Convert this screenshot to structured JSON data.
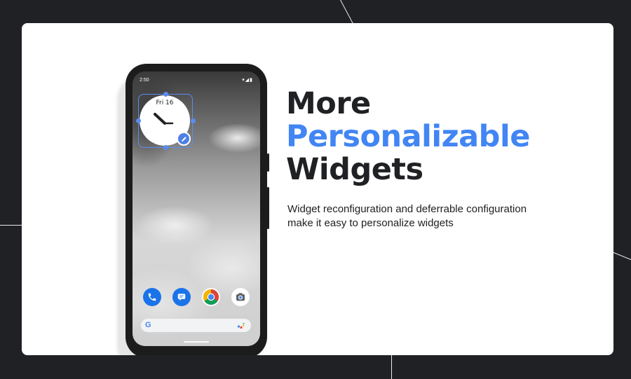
{
  "phone": {
    "status_time": "2:50",
    "status_icons": "▾◢▮",
    "clock_widget": {
      "date": "Fri 16"
    },
    "dock_icons": [
      "phone-icon",
      "messages-icon",
      "chrome-icon",
      "camera-icon"
    ],
    "search_bar": {
      "logo": "G",
      "assistant_icon": "assistant-icon"
    }
  },
  "headline": {
    "line1": "More",
    "line2": "Personalizable",
    "line3": "Widgets"
  },
  "subtitle": {
    "line1": "Widget reconfiguration and deferrable configuration",
    "line2": "make it easy to personalize widgets"
  },
  "colors": {
    "background": "#202124",
    "card": "#ffffff",
    "accent_blue": "#4285f4",
    "text_dark": "#202124",
    "widget_selection": "#5b8def"
  }
}
